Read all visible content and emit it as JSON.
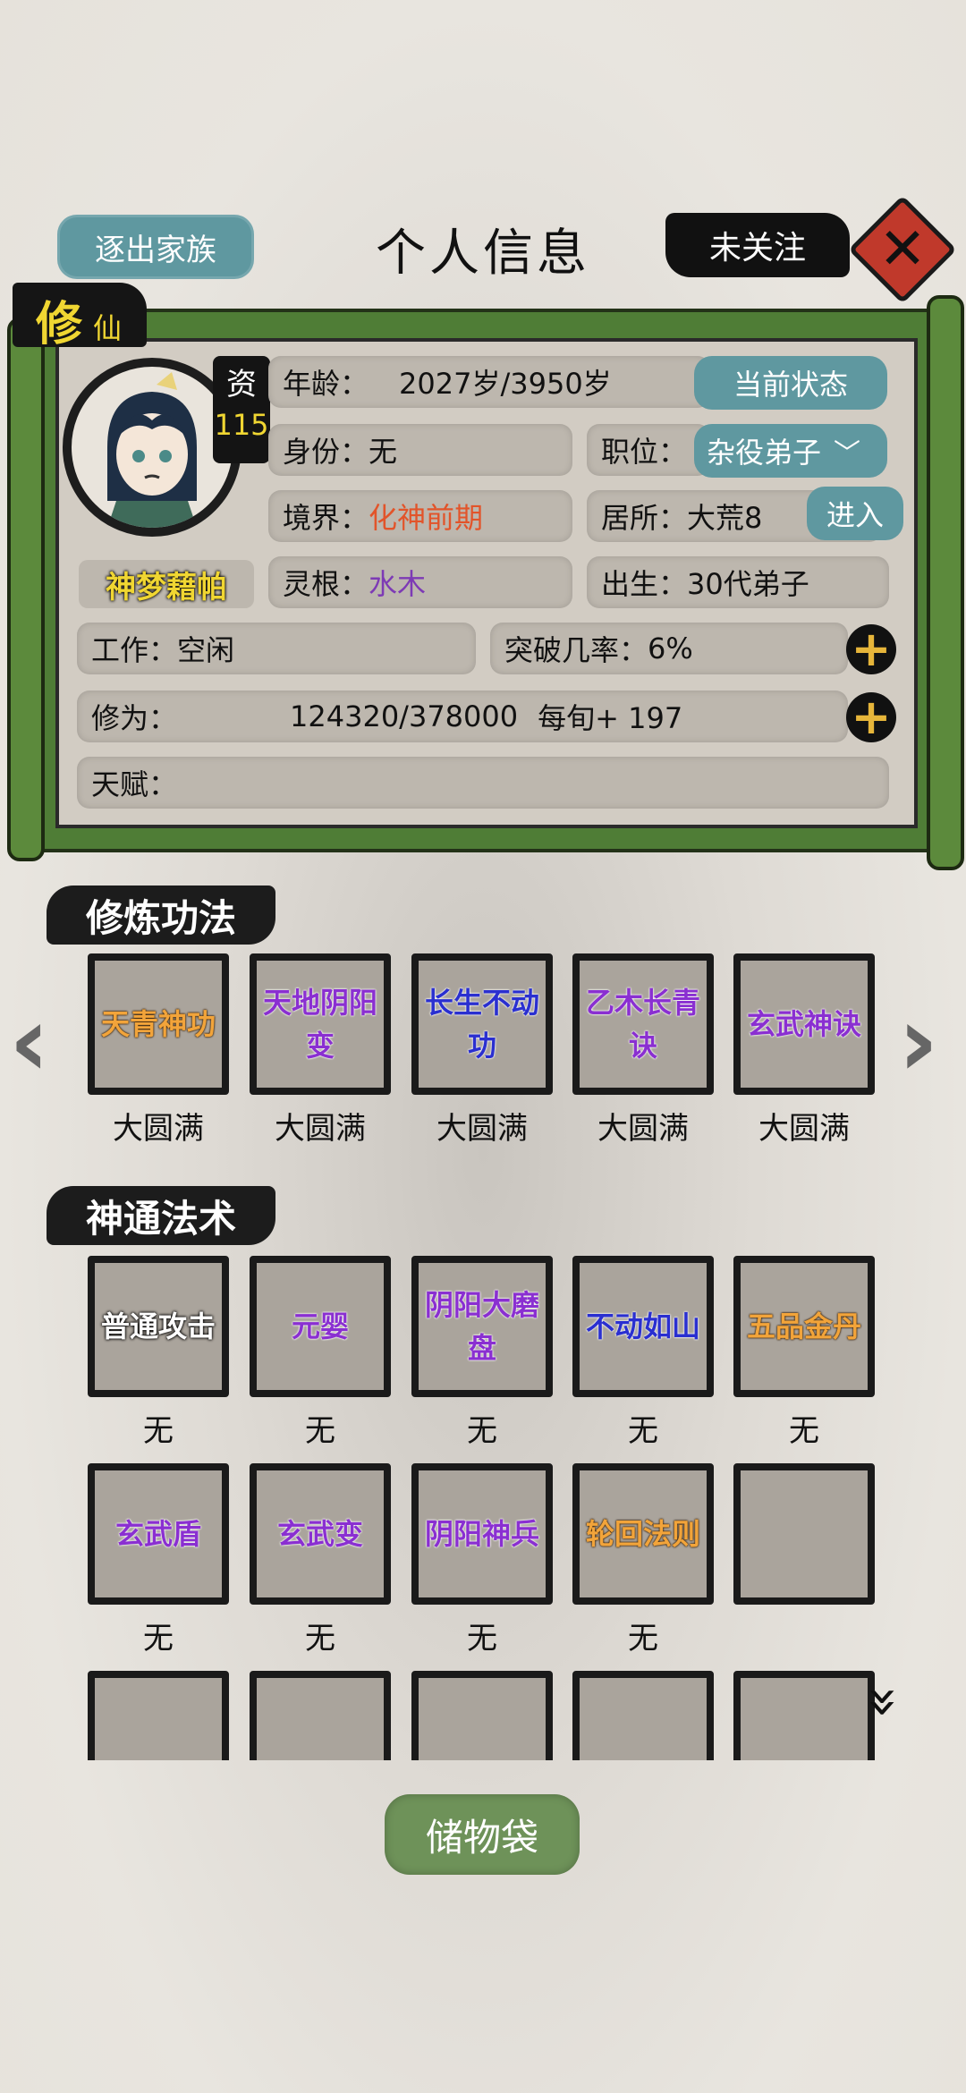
{
  "header": {
    "expel_label": "逐出家族",
    "title": "个人信息",
    "follow_label": "未关注"
  },
  "profile": {
    "xiu_big": "修",
    "xiu_small": "仙",
    "aptitude_label": "资",
    "aptitude_value": "115",
    "name": "神梦藉帕",
    "age_label": "年龄：",
    "age_value": "2027岁/3950岁",
    "status_button": "当前状态",
    "identity_label": "身份：",
    "identity_value": "无",
    "position_label": "职位：",
    "position_value": "杂役弟子",
    "realm_label": "境界：",
    "realm_value": "化神前期",
    "residence_label": "居所：",
    "residence_value": "大荒8",
    "enter_button": "进入",
    "root_label": "灵根：",
    "root_value": "水木",
    "birth_label": "出生：",
    "birth_value": "30代弟子",
    "work_label": "工作：",
    "work_value": "空闲",
    "breakthrough_label": "突破几率：",
    "breakthrough_value": "6%",
    "cultivation_label": "修为：",
    "cultivation_value": "124320/378000",
    "cultivation_rate": "每旬+ 197",
    "talent_label": "天赋：",
    "talent_value": ""
  },
  "techniques": {
    "title": "修炼功法",
    "items": [
      {
        "name": "天青神功",
        "level": "大圆满",
        "color": "#f2a43a"
      },
      {
        "name": "天地阴阳变",
        "level": "大圆满",
        "color": "#8a2fd1"
      },
      {
        "name": "长生不动功",
        "level": "大圆满",
        "color": "#2a2fd0"
      },
      {
        "name": "乙木长青诀",
        "level": "大圆满",
        "color": "#8a2fd1"
      },
      {
        "name": "玄武神诀",
        "level": "大圆满",
        "color": "#8a2fd1"
      }
    ]
  },
  "spells": {
    "title": "神通法术",
    "row1": [
      {
        "name": "普通攻击",
        "level": "无",
        "color": "#ffffff"
      },
      {
        "name": "元婴",
        "level": "无",
        "color": "#8a2fd1"
      },
      {
        "name": "阴阳大磨盘",
        "level": "无",
        "color": "#8a2fd1"
      },
      {
        "name": "不动如山",
        "level": "无",
        "color": "#2a2fd0"
      },
      {
        "name": "五品金丹",
        "level": "无",
        "color": "#f2a43a"
      }
    ],
    "row2": [
      {
        "name": "玄武盾",
        "level": "无",
        "color": "#8a2fd1"
      },
      {
        "name": "玄武变",
        "level": "无",
        "color": "#8a2fd1"
      },
      {
        "name": "阴阳神兵",
        "level": "无",
        "color": "#8a2fd1"
      },
      {
        "name": "轮回法则",
        "level": "无",
        "color": "#f2a43a"
      },
      {
        "name": "",
        "level": ""
      }
    ]
  },
  "footer": {
    "bag_label": "储物袋"
  }
}
